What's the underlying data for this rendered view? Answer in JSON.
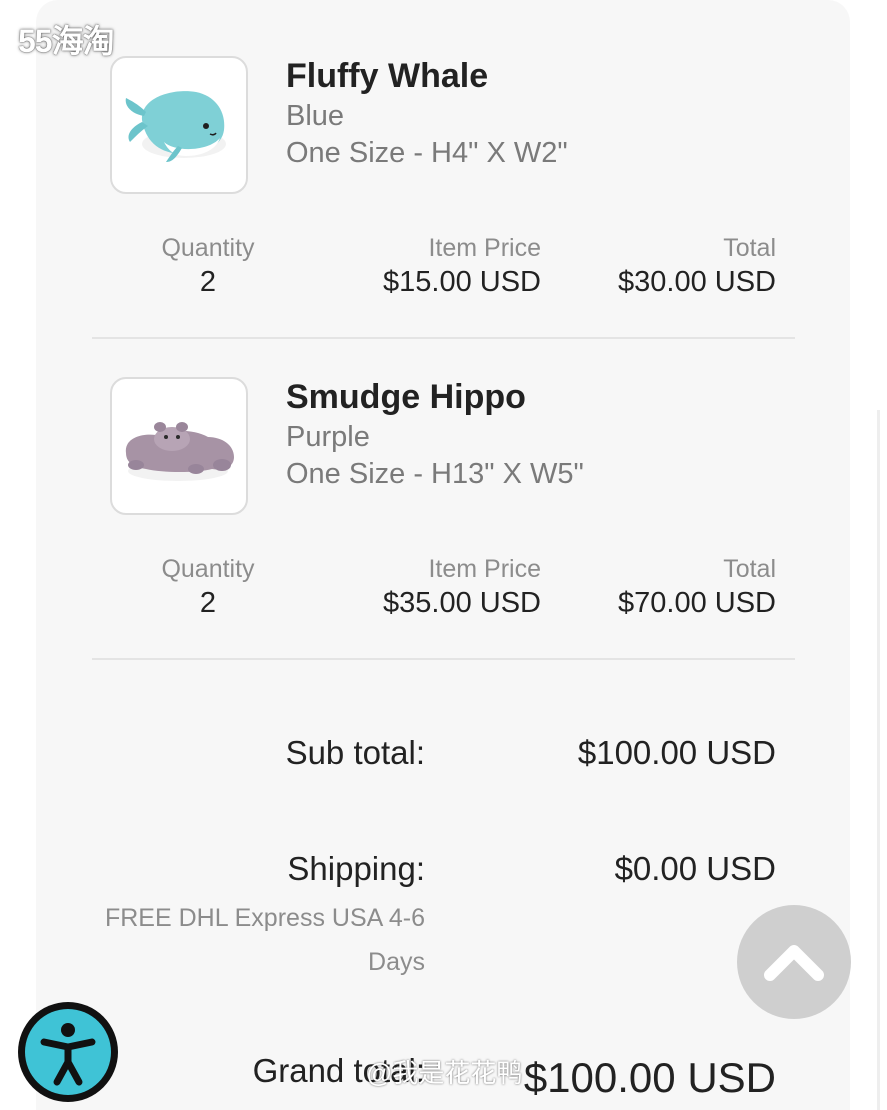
{
  "watermark": {
    "top_left": "55海淘",
    "bottom": "@我是花花鸭"
  },
  "items": [
    {
      "name": "Fluffy Whale",
      "color": "Blue",
      "size": "One Size - H4\" X W2\"",
      "image_icon": "whale-plush",
      "quantity_label": "Quantity",
      "quantity": "2",
      "item_price_label": "Item Price",
      "item_price": "$15.00 USD",
      "total_label": "Total",
      "total": "$30.00 USD"
    },
    {
      "name": "Smudge Hippo",
      "color": "Purple",
      "size": "One Size - H13\" X W5\"",
      "image_icon": "hippo-plush",
      "quantity_label": "Quantity",
      "quantity": "2",
      "item_price_label": "Item Price",
      "item_price": "$35.00 USD",
      "total_label": "Total",
      "total": "$70.00 USD"
    }
  ],
  "summary": {
    "subtotal_label": "Sub total:",
    "subtotal": "$100.00 USD",
    "shipping_label": "Shipping:",
    "shipping_method": "FREE DHL Express USA 4-6 Days",
    "shipping": "$0.00 USD",
    "grand_total_label": "Grand total:",
    "grand_total": "$100.00 USD"
  },
  "controls": {
    "scroll_top_icon": "chevron-up-icon",
    "accessibility_icon": "accessibility-icon"
  },
  "colors": {
    "card_bg": "#f7f7f7",
    "accessibility_accent": "#3fc3d6",
    "scroll_button": "#cfcfcf",
    "muted_text": "#8c8c8c"
  }
}
